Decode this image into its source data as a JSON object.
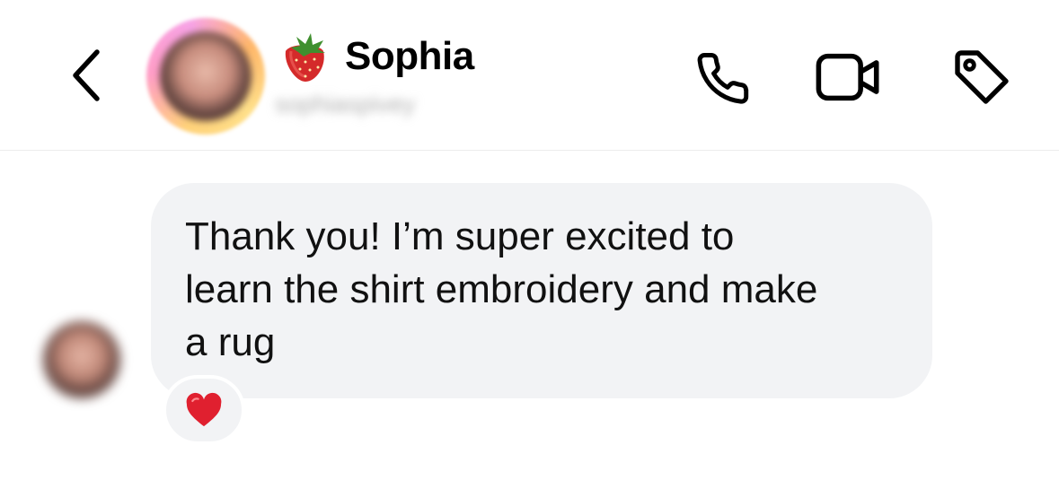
{
  "header": {
    "contact_name": "Sophia",
    "username": "sophiaspivey",
    "back_icon": "chevron-left-icon",
    "name_emoji_icon": "strawberry-icon",
    "actions": [
      {
        "id": "call",
        "icon": "phone-icon"
      },
      {
        "id": "video",
        "icon": "video-camera-icon"
      },
      {
        "id": "tag",
        "icon": "tag-icon"
      }
    ]
  },
  "conversation": {
    "messages": [
      {
        "sender": "Sophia",
        "text": "Thank you! I’m super excited to\nlearn the shirt embroidery and make\na rug",
        "reaction_icon": "red-heart-icon"
      }
    ]
  },
  "colors": {
    "bubble_background": "#f2f3f5",
    "reaction_heart": "#e0202f",
    "avatar_ring_gradient": [
      "#ffd27a",
      "#ff9ec6",
      "#f7a3e6",
      "#ffb86b"
    ]
  }
}
